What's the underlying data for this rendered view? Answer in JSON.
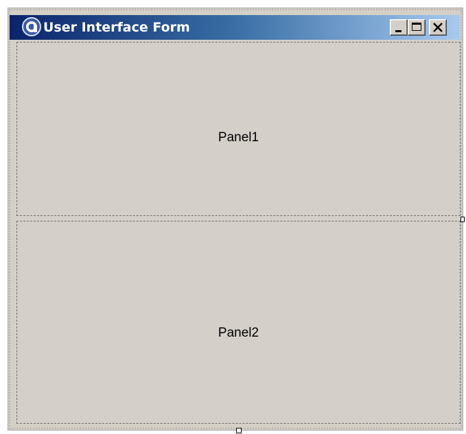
{
  "window": {
    "title": "User Interface Form",
    "title_bar_color_start": "#0a246a",
    "title_bar_color_end": "#a6caf0",
    "icon": "app-logo-icon",
    "controls": {
      "minimize_icon": "minimize-icon",
      "maximize_icon": "maximize-icon",
      "close_icon": "close-icon"
    }
  },
  "panels": [
    {
      "label": "Panel1"
    },
    {
      "label": "Panel2"
    }
  ],
  "colors": {
    "form_background": "#d4d0c8",
    "panel_border": "#6e6e6e"
  }
}
